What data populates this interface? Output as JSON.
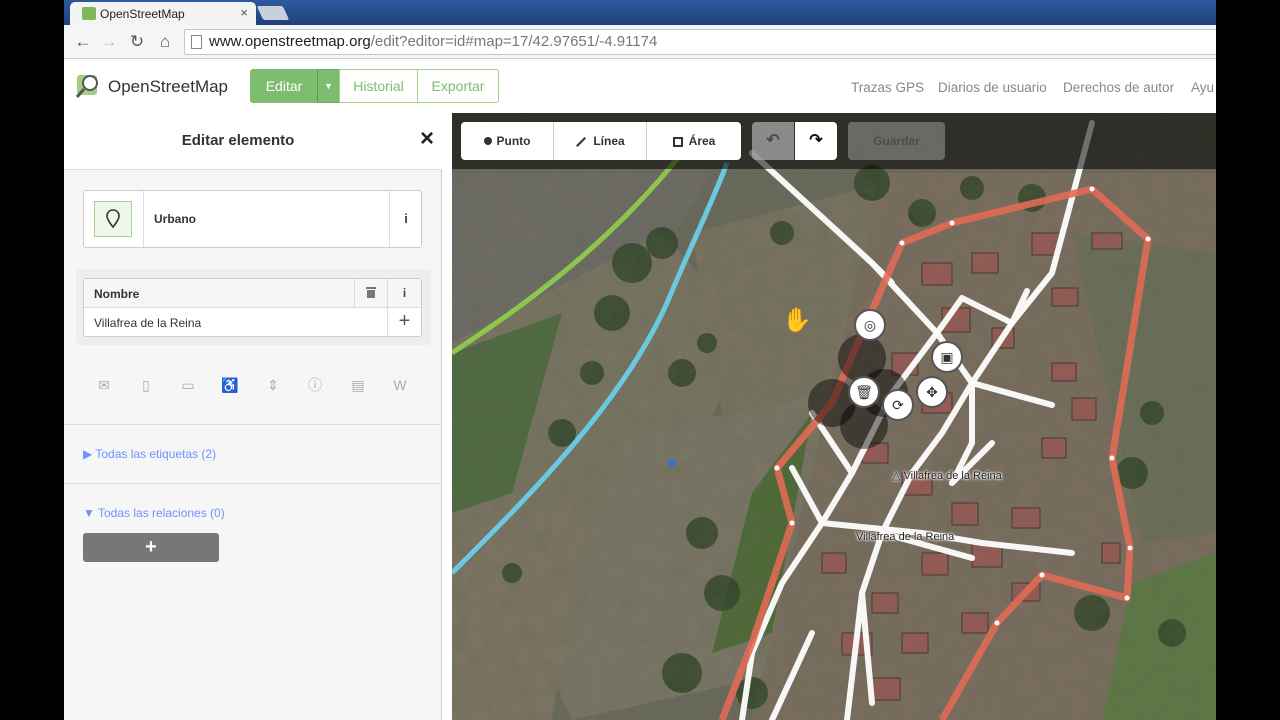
{
  "browser": {
    "tab_title": "OpenStreetMap",
    "tab_close": "×",
    "url_host": "www.openstreetmap.org",
    "url_path": "/edit?editor=id#map=17/42.97651/-4.91174",
    "nav": {
      "back": "←",
      "forward": "→",
      "reload": "↻",
      "home": "⌂"
    }
  },
  "header": {
    "brand": "OpenStreetMap",
    "edit_label": "Editar",
    "edit_dropdown": "▼",
    "history_label": "Historial",
    "export_label": "Exportar",
    "links": [
      "Trazas GPS",
      "Diarios de usuario",
      "Derechos de autor",
      "Ayu"
    ],
    "accent_color": "#7ebc6f"
  },
  "sidebar": {
    "title": "Editar elemento",
    "close": "×",
    "preset": {
      "name": "Urbano",
      "info": "i",
      "icon": "pin-icon"
    },
    "name_field": {
      "label": "Nombre",
      "value": "Villafrea de la Reina",
      "info": "i",
      "add": "+",
      "trash_icon": "trash-icon"
    },
    "field_icons": [
      "email-icon",
      "phone-icon",
      "website-icon",
      "wheelchair-icon",
      "elevation-icon",
      "operator-icon",
      "address-icon",
      "wikipedia-icon"
    ],
    "field_glyphs": [
      "✉",
      "▯",
      "▭",
      "♿",
      "⇕",
      "ⓘ",
      "▤",
      "W"
    ],
    "all_tags": "▶ Todas las etiquetas (2)",
    "all_relations": "▼ Todas las relaciones (0)",
    "add_relation": "+",
    "link_color": "#7092ff"
  },
  "map": {
    "toolbar": {
      "point": "Punto",
      "line": "Línea",
      "area": "Área",
      "undo": "↶",
      "redo": "↷",
      "save": "Guardar"
    },
    "labels": {
      "place_small": "Villafrea de la Reina",
      "place_large": "Villafrea de la Reina"
    },
    "radial_menu": [
      "circularize-icon",
      "square-icon",
      "move-icon",
      "delete-icon",
      "continue-icon"
    ],
    "colors": {
      "boundary": "#e06a55",
      "river": "#6ac9e0",
      "road_green": "#8fd04a",
      "street": "#ffffff"
    }
  }
}
